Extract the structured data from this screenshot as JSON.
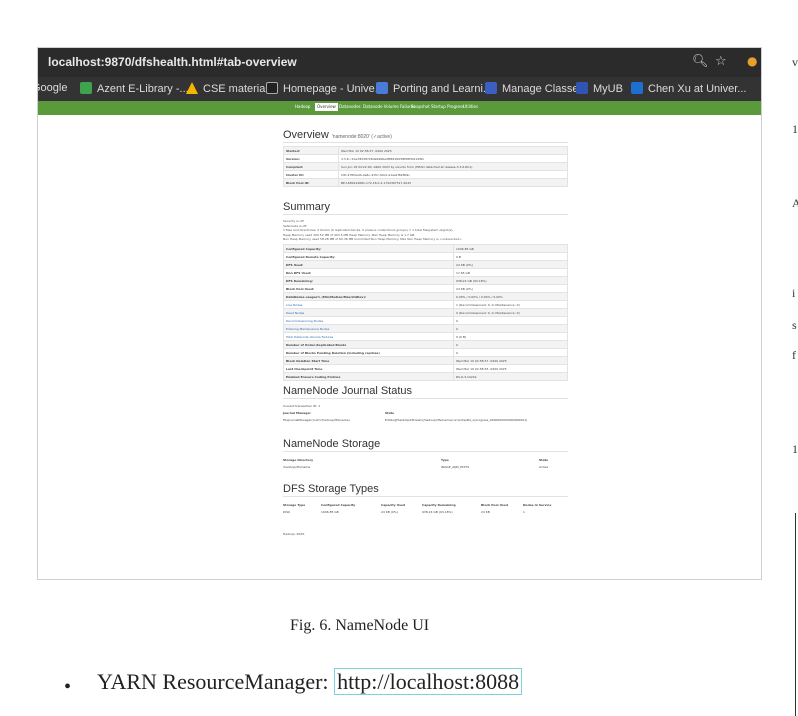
{
  "browser": {
    "url": "localhost:9870/dfshealth.html#tab-overview",
    "zoom_icon": "magnifier-icon",
    "star_icon": "star-icon",
    "bookmarks": [
      {
        "label": "Google",
        "icon": "google-icon",
        "color": ""
      },
      {
        "label": "Azent E-Library -...",
        "icon": "plus-icon",
        "color": "#3fa34d"
      },
      {
        "label": "CSE materials",
        "icon": "drive-icon",
        "color": "#f4b400"
      },
      {
        "label": "Homepage - Unive...",
        "icon": "iu-icon",
        "color": "#222222"
      },
      {
        "label": "Porting and Learni...",
        "icon": "doc-icon",
        "color": "#4a7bd8"
      },
      {
        "label": "Manage Classes",
        "icon": "class-icon",
        "color": "#3b5fc0"
      },
      {
        "label": "MyUB",
        "icon": "ub-icon",
        "color": "#2f55b0"
      },
      {
        "label": "Chen Xu at Univer...",
        "icon": "link-icon",
        "color": "#1f6fd0"
      }
    ]
  },
  "navbar": {
    "items": [
      "Hadoop",
      "Overview",
      "Datanodes",
      "Datanode Volume Failures",
      "Snapshot",
      "Startup Progress",
      "Utilities"
    ],
    "active_index": 1,
    "color": "#5b9a3b"
  },
  "overview": {
    "title": "Overview",
    "subtitle": "'namenode:8020' (✓active)",
    "rows": [
      [
        "Started:",
        "Wed Mar 19 02:58:37 -0400 2025"
      ],
      [
        "Version:",
        "3.3.6, r1be78238728da9266a4f88195058f08fd012bf9c"
      ],
      [
        "Compiled:",
        "Sun Jun 18 04:22:00 -0400 2023 by ubuntu from (HEAD detached at release-3.3.6-RC1)"
      ],
      [
        "Cluster ID:",
        "CID-47fb5ad4-4e6c-4157-90cd-a1ae1f62809c"
      ],
      [
        "Block Pool ID:",
        "BP-1689144681-172.18.0.4-1742367517-2025"
      ]
    ]
  },
  "summary": {
    "title": "Summary",
    "lines": [
      "Security is off.",
      "Safemode is off.",
      "1 files and directories, 0 blocks (0 replicated blocks, 0 erasure coded block groups) = 1 total filesystem object(s).",
      "Heap Memory used 300.52 MB of 403.5 MB Heap Memory. Max Heap Memory is 1.7 GB.",
      "Non Heap Memory used 58.28 MB of 60.38 MB Commited Non Heap Memory. Max Non Heap Memory is <unbounded>."
    ],
    "rows": [
      {
        "k": "Configured Capacity:",
        "v": "1006.85 GB",
        "link": false
      },
      {
        "k": "Configured Remote Capacity:",
        "v": "0 B",
        "link": false
      },
      {
        "k": "DFS Used:",
        "v": "24 KB (0%)",
        "link": false
      },
      {
        "k": "Non DFS Used:",
        "v": "17.65 GB",
        "link": false
      },
      {
        "k": "DFS Remaining:",
        "v": "938.24 GB (93.18%)",
        "link": false
      },
      {
        "k": "Block Pool Used:",
        "v": "24 KB (0%)",
        "link": false
      },
      {
        "k": "DataNodes usages% (Min/Median/Max/stdDev):",
        "v": "0.00% / 0.00% / 0.00% / 0.00%",
        "link": false
      },
      {
        "k": "Live Nodes",
        "v": "1 (Decommissioned: 0, In Maintenance: 0)",
        "link": true
      },
      {
        "k": "Dead Nodes",
        "v": "0 (Decommissioned: 0, In Maintenance: 0)",
        "link": true
      },
      {
        "k": "Decommissioning Nodes",
        "v": "0",
        "link": true
      },
      {
        "k": "Entering Maintenance Nodes",
        "v": "0",
        "link": true
      },
      {
        "k": "Total Datanode Volume Failures",
        "v": "0 (0 B)",
        "link": true
      },
      {
        "k": "Number of Under-Replicated Blocks",
        "v": "0",
        "link": false
      },
      {
        "k": "Number of Blocks Pending Deletion (including replicas)",
        "v": "0",
        "link": false
      },
      {
        "k": "Block Deletion Start Time",
        "v": "Wed Mar 19 02:58:37 -0400 2025",
        "link": false
      },
      {
        "k": "Last Checkpoint Time",
        "v": "Wed Mar 19 02:58:35 -0400 2025",
        "link": false
      },
      {
        "k": "Enabled Erasure Coding Policies",
        "v": "RS-6-3-1024k",
        "link": false
      }
    ]
  },
  "journal": {
    "title": "NameNode Journal Status",
    "txid_label": "Current transaction ID: 1",
    "headers": [
      "Journal Manager",
      "State"
    ],
    "row": [
      "FileJournalManager(root=/hadoop/dfs/name)",
      "EditLogFileOutputStream(/hadoop/dfs/name/current/edits_inprogress_0000000000000000001)"
    ]
  },
  "storage": {
    "title": "NameNode Storage",
    "headers": [
      "Storage Directory",
      "Type",
      "State"
    ],
    "row": [
      "/hadoop/dfs/name",
      "IMAGE_AND_EDITS",
      "Active"
    ]
  },
  "storage_types": {
    "title": "DFS Storage Types",
    "headers": [
      "Storage Type",
      "Configured Capacity",
      "Capacity Used",
      "Capacity Remaining",
      "Block Pool Used",
      "Nodes In Service"
    ],
    "row": [
      "DISK",
      "1006.85 GB",
      "24 KB (0%)",
      "938.24 GB (93.18%)",
      "24 KB",
      "1"
    ]
  },
  "footer": "Hadoop, 2025.",
  "caption": "Fig. 6.  NameNode UI",
  "bullet": {
    "label": "YARN ResourceManager: ",
    "link": "http://localhost:8088"
  }
}
